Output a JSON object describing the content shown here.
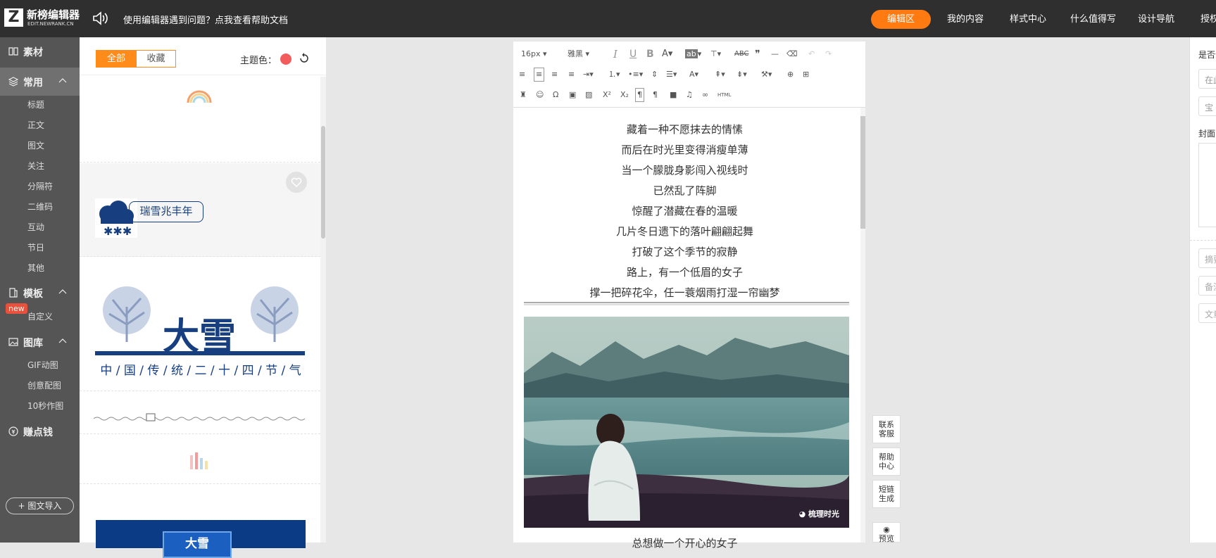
{
  "topbar": {
    "logo_name": "新榜编辑器",
    "logo_sub": "EDIT.NEWRANK.CN",
    "help_text": "使用编辑器遇到问题？点我查看帮助文档",
    "nav": [
      "编辑区",
      "我的内容",
      "样式中心",
      "什么值得写",
      "设计导航",
      "授权"
    ],
    "accent": "#ff7a10"
  },
  "sidebar": {
    "material": "素材",
    "common": "常用",
    "common_items": [
      "标题",
      "正文",
      "图文",
      "关注",
      "分隔符",
      "二维码",
      "互动",
      "节日",
      "其他"
    ],
    "new_badge": "new",
    "template": "模板",
    "template_items": [
      "自定义"
    ],
    "gallery": "图库",
    "gallery_items": [
      "GIF动图",
      "创意配图",
      "10秒作图"
    ],
    "earn": "赚点钱",
    "import": "图文导入"
  },
  "panel": {
    "tab_all": "全部",
    "tab_fav": "收藏",
    "theme_label": "主题色：",
    "theme_color": "#f35c5c",
    "card_snow_label": "瑞雪兆丰年",
    "card_daxue_title": "大雪",
    "card_daxue_sub": "中 / 国 / 传 / 统 / 二 / 十 / 四 / 节 / 气",
    "card_blue_title": "大雪"
  },
  "toolbar": {
    "font_size": "16px",
    "font_family": "雅黑",
    "html_label": "HTML"
  },
  "editor": {
    "poem": [
      "藏着一种不愿抹去的情愫",
      "而后在时光里变得消瘦单薄",
      "当一个朦胧身影闯入视线时",
      "已然乱了阵脚",
      "惊醒了潜藏在春的温暖",
      "几片冬日遗下的落叶翩翩起舞",
      "打破了这个季节的寂静",
      "路上，有一个低眉的女子",
      "撑一把碎花伞，任一蓑烟雨打湿一帘幽梦"
    ],
    "watermark": "梳理时光",
    "trailing_line": "总想做一个开心的女子"
  },
  "float_buttons": [
    "联系客服",
    "帮助中心",
    "短链生成",
    "预览"
  ],
  "right_panel": {
    "question": "是否全",
    "field1": "在此",
    "field2": "宝",
    "cover": "封面",
    "box1": "摘要",
    "box2": "备注",
    "box3": "文章"
  }
}
